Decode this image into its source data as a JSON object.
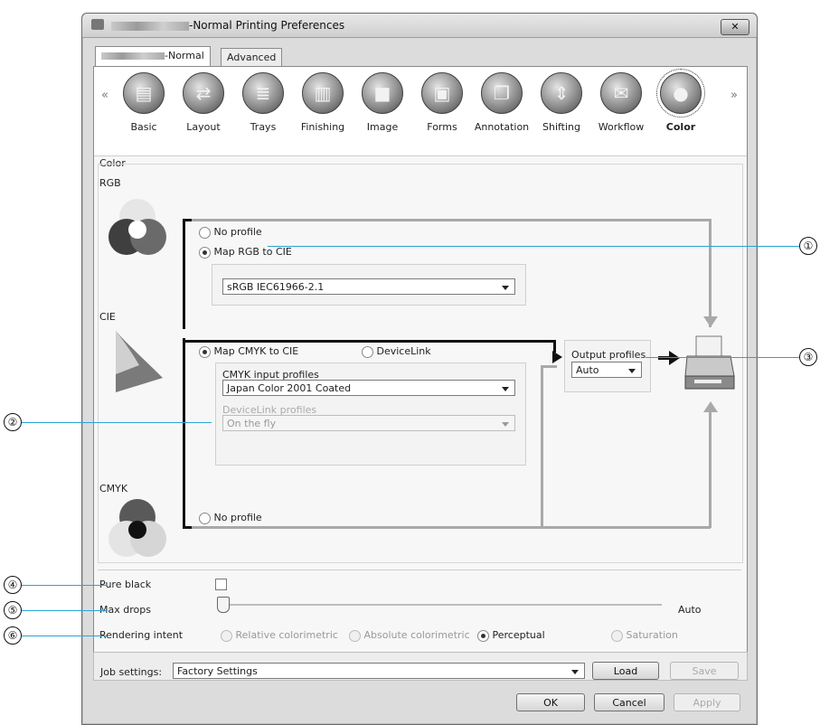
{
  "window": {
    "title_suffix": "-Normal Printing Preferences",
    "close_label": "✕"
  },
  "tabs": [
    {
      "label": "-Normal"
    },
    {
      "label": "Advanced"
    }
  ],
  "categories": [
    {
      "label": "Basic",
      "icon": "document-icon"
    },
    {
      "label": "Layout",
      "icon": "layout-icon"
    },
    {
      "label": "Trays",
      "icon": "trays-icon"
    },
    {
      "label": "Finishing",
      "icon": "finishing-icon"
    },
    {
      "label": "Image",
      "icon": "image-icon"
    },
    {
      "label": "Forms",
      "icon": "forms-icon"
    },
    {
      "label": "Annotation",
      "icon": "annotation-icon"
    },
    {
      "label": "Shifting",
      "icon": "shifting-icon"
    },
    {
      "label": "Workflow",
      "icon": "workflow-icon"
    },
    {
      "label": "Color",
      "icon": "color-icon"
    }
  ],
  "color": {
    "group_label": "Color",
    "rgb_label": "RGB",
    "cie_label": "CIE",
    "cmyk_label": "CMYK",
    "rgb_no_profile": "No profile",
    "rgb_map": "Map RGB to CIE",
    "rgb_profile_value": "sRGB IEC61966-2.1",
    "map_cmyk": "Map CMYK to CIE",
    "devicelink": "DeviceLink",
    "cmyk_input_label": "CMYK input profiles",
    "cmyk_input_value": "Japan Color 2001 Coated",
    "devicelink_label": "DeviceLink profiles",
    "devicelink_value": "On the fly",
    "cmyk_no_profile": "No profile",
    "output_label": "Output profiles",
    "output_value": "Auto"
  },
  "options": {
    "pure_black": "Pure black",
    "max_drops": "Max drops",
    "max_drops_value": "Auto",
    "rendering_intent": "Rendering intent",
    "intents": [
      "Relative colorimetric",
      "Absolute colorimetric",
      "Perceptual",
      "Saturation"
    ]
  },
  "job": {
    "label": "Job settings:",
    "value": "Factory Settings",
    "load": "Load",
    "save": "Save"
  },
  "footer": {
    "ok": "OK",
    "cancel": "Cancel",
    "apply": "Apply"
  },
  "callouts": [
    "①",
    "②",
    "③",
    "④",
    "⑤",
    "⑥"
  ],
  "colors": {
    "callout": "#2aa3d6",
    "flow_dark": "#111111",
    "flow_gray": "#a9a9a9"
  }
}
